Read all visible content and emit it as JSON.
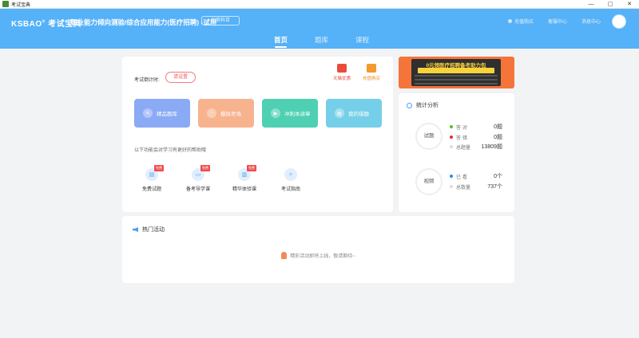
{
  "window": {
    "title": "考试宝典",
    "controls": {
      "minimize": "—",
      "maximize": "▢",
      "close": "✕"
    }
  },
  "header": {
    "logo": "KSBAO",
    "logo_mark": "®",
    "logo_name": "考试宝典",
    "course": "职业能力倾向测验/综合应用能力(医疗招聘) -试用",
    "switch_course": "切换科目",
    "links": [
      "充值购买",
      "客服中心",
      "消息中心"
    ]
  },
  "nav": {
    "tabs": [
      "首页",
      "题库",
      "课程"
    ],
    "active": 0
  },
  "main": {
    "timer_label": "考试倒计时:",
    "timer_button": "请设置",
    "shop": [
      "天猫优惠",
      "充值购买"
    ],
    "tiles": [
      "精品题库",
      "模拟考场",
      "冲刺本讲章",
      "我的错题"
    ],
    "help_text": "以下功能会对学习有更好的帮助哦",
    "features": [
      {
        "label": "免费试题",
        "badge": "免费"
      },
      {
        "label": "备考导学课",
        "badge": "免费"
      },
      {
        "label": "精华体验课",
        "badge": "免费"
      },
      {
        "label": "考试指南",
        "badge": ""
      }
    ]
  },
  "banner": {
    "headline": "0元领医疗招聘备考助力包"
  },
  "stats": {
    "title": "统计分析",
    "questions": {
      "ring_label": "试题",
      "rows": [
        {
          "label": "答对",
          "value": "0题",
          "color": "#52c41a"
        },
        {
          "label": "答错",
          "value": "0题",
          "color": "#f5222d"
        },
        {
          "label": "总题量",
          "value": "13809题",
          "color": "#dddddd"
        }
      ]
    },
    "videos": {
      "ring_label": "视频",
      "rows": [
        {
          "label": "已看",
          "value": "0个",
          "color": "#1890ff"
        },
        {
          "label": "总数量",
          "value": "737个",
          "color": "#dddddd"
        }
      ]
    }
  },
  "hot": {
    "title": "热门活动",
    "empty_message": "精彩活动即将上线，敬请期待~"
  }
}
